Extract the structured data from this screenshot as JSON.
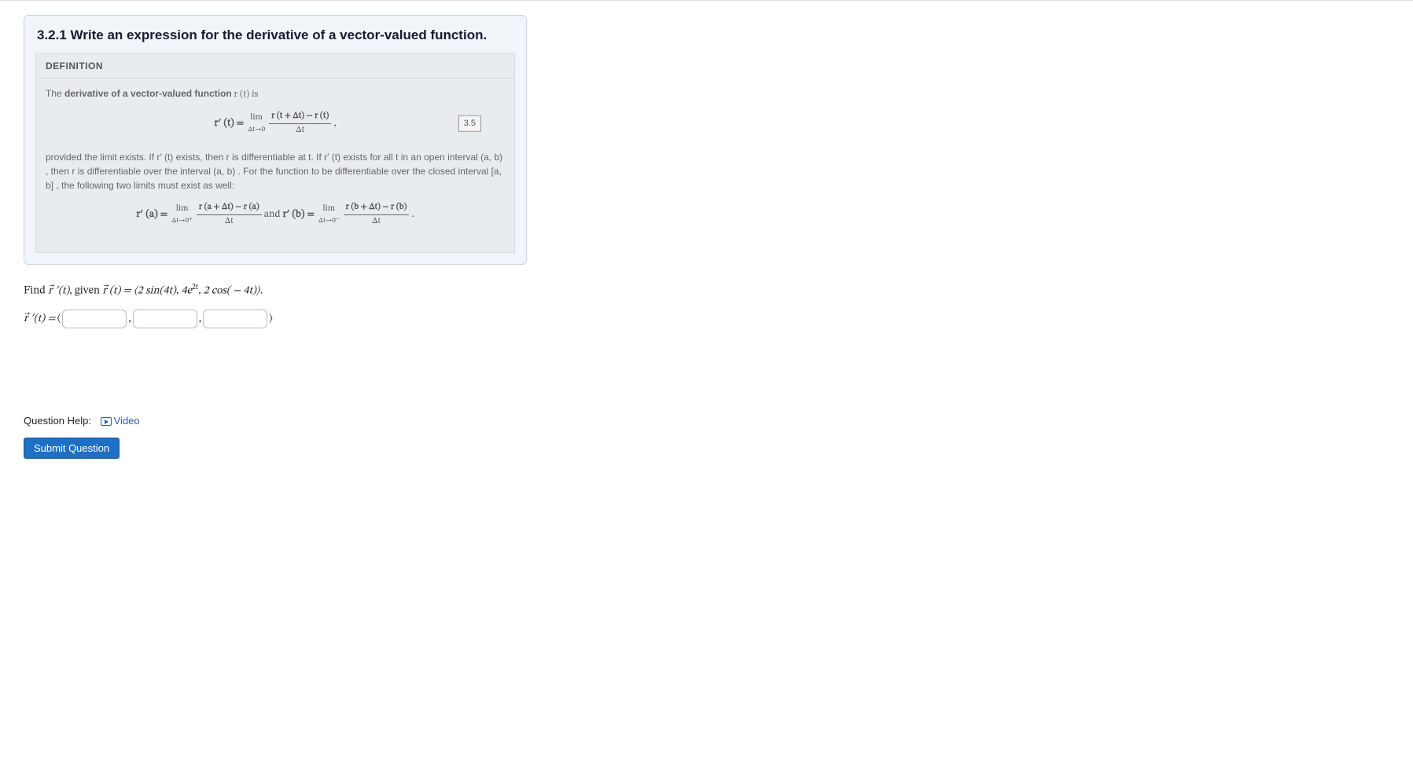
{
  "card": {
    "title": "3.2.1 Write an expression for the derivative of a vector-valued function."
  },
  "definition": {
    "header": "DEFINITION",
    "intro_pre": "The ",
    "intro_bold": "derivative of a vector-valued function",
    "intro_post": " r (t) is",
    "eq_tag": "3.5",
    "para": "provided the limit exists. If r′ (t) exists, then r is differentiable at t. If r′ (t) exists for all t in an open interval (a, b) , then r is differentiable over the interval (a, b) . For the function to be differentiable over the closed interval [a, b] , the following two limits must exist as well:",
    "eq1_lhs": "r′ (t) = ",
    "eq1_lim_top": "lim",
    "eq1_lim_bot": "Δt→0",
    "eq1_num": "r (t + Δt) − r (t)",
    "eq1_den": "Δt",
    "eq2_a_lhs": "r′ (a) = ",
    "eq2_a_lim_top": "lim",
    "eq2_a_lim_bot": "Δt→0⁺",
    "eq2_a_num": "r (a + Δt) − r (a)",
    "eq2_a_den": "Δt",
    "eq2_join": " and ",
    "eq2_b_lhs": "r′ (b) = ",
    "eq2_b_lim_top": "lim",
    "eq2_b_lim_bot": "Δt→0⁻",
    "eq2_b_num": "r (b + Δt) − r (b)",
    "eq2_b_den": "Δt",
    "eq2_tail": " ."
  },
  "question": {
    "find_pre": "Find ",
    "find_target": "r⃗ ′(t)",
    "given": ", given ",
    "rvec": "r⃗ (t) = ⟨2 sin(4t), 4e",
    "rvec_sup": "2t",
    "rvec_tail": ", 2 cos( − 4t)⟩.",
    "answer_label": "r⃗ ′(t) = ",
    "bracket_open": "⟨",
    "bracket_close": "⟩",
    "comma": ","
  },
  "help": {
    "label": "Question Help:",
    "video": "Video"
  },
  "submit": {
    "label": "Submit Question"
  }
}
